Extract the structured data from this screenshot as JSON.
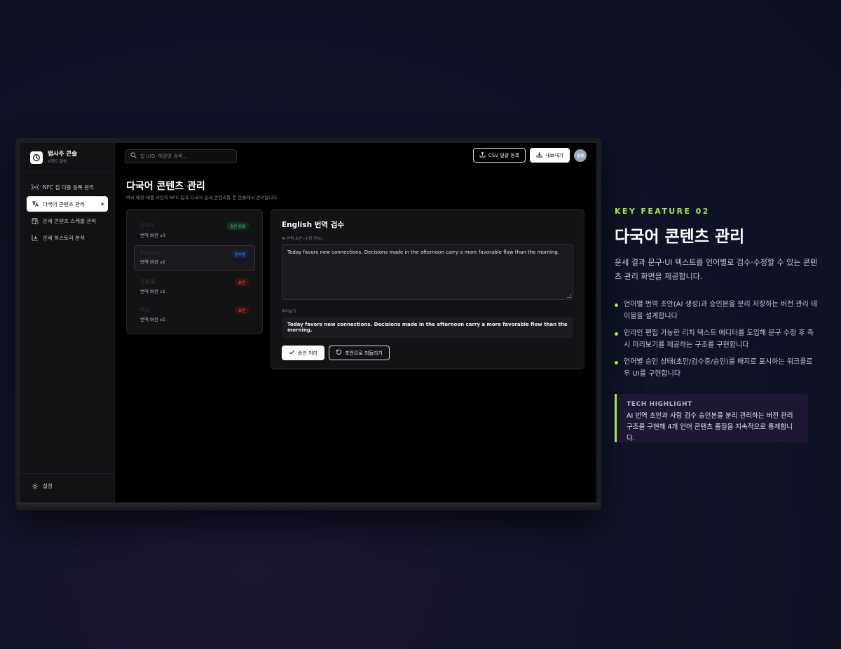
{
  "brand": {
    "name": "탭사주 콘솔",
    "sub": "브랜드 운영"
  },
  "nav": [
    {
      "label": "NFC 칩 다중 등록 관리",
      "icon": "nfc-signal-icon"
    },
    {
      "label": "다국어 콘텐츠 관리",
      "icon": "translate-icon",
      "active": true
    },
    {
      "label": "운세 콘텐츠 스케줄 관리",
      "icon": "calendar-clock-icon"
    },
    {
      "label": "운세 히스토리 분석",
      "icon": "bar-chart-icon"
    }
  ],
  "settings_label": "설정",
  "search": {
    "placeholder": "칩 UID, 매장명 검색..."
  },
  "top_actions": {
    "csv": "CSV 일괄 등록",
    "export": "내보내기",
    "avatar": "운영"
  },
  "page": {
    "title": "다국어 콘텐츠 관리",
    "desc": "여러 매장·제품 라인의 NFC 칩과 다국어 운세 콘텐츠를 한 콘솔에서 관리합니다."
  },
  "languages": [
    {
      "name": "한국어",
      "version": "번역 버전 v3",
      "status": "승인 완료",
      "status_color": "green"
    },
    {
      "name": "English",
      "version": "번역 버전 v2",
      "status": "검수중",
      "status_color": "blue",
      "active": true
    },
    {
      "name": "日本語",
      "version": "번역 버전 v1",
      "status": "초안",
      "status_color": "red"
    },
    {
      "name": "中文",
      "version": "번역 버전 v1",
      "status": "초안",
      "status_color": "red"
    }
  ],
  "editor": {
    "title": "English 번역 검수",
    "draft_label": "AI 번역 초안 (수정 가능)",
    "draft_text": "Today favors new connections. Decisions made in the afternoon carry a more favorable flow than the morning.",
    "preview_label": "미리보기",
    "preview_text": "Today favors new connections. Decisions made in the afternoon carry a more favorable flow than the morning.",
    "approve": "승인 처리",
    "revert": "초안으로 되돌리기"
  },
  "feature": {
    "eyebrow": "KEY FEATURE 02",
    "title": "다국어 콘텐츠 관리",
    "desc": "운세 결과 문구·UI 텍스트를 언어별로 검수·수정할 수 있는 콘텐츠 관리 화면을 제공합니다.",
    "bullets": [
      "언어별 번역 초안(AI 생성)과 승인본을 분리 저장하는 버전 관리 테이블을 설계합니다",
      "인라인 편집 가능한 리치 텍스트 에디터를 도입해 문구 수정 후 즉시 미리보기를 제공하는 구조를 구현합니다",
      "언어별 승인 상태(초안/검수중/승인)를 배지로 표시하는 워크플로우 UI를 구현합니다"
    ],
    "tech_title": "TECH HIGHLIGHT",
    "tech_text": "AI 번역 초안과 사람 검수 승인본을 분리 관리하는 버전 관리 구조를 구현해 4개 언어 콘텐츠 품질을 지속적으로 통제합니다."
  },
  "colors": {
    "accent": "#a6e34a",
    "badge_green": "#56d07e",
    "badge_blue": "#5a9cf5",
    "badge_red": "#e86a5a"
  }
}
